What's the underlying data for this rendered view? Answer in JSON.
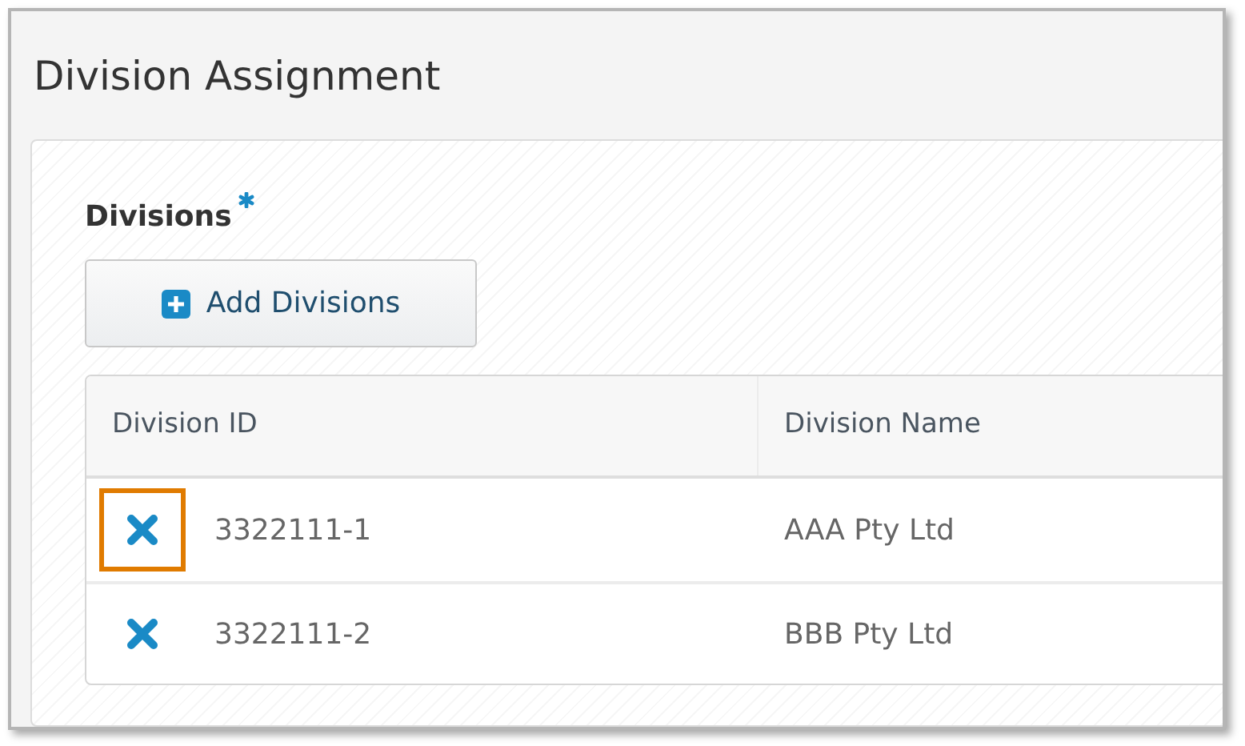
{
  "title": "Division Assignment",
  "section": {
    "label": "Divisions",
    "required": true
  },
  "add_button": {
    "label": "Add Divisions"
  },
  "table": {
    "columns": [
      "Division ID",
      "Division Name"
    ],
    "rows": [
      {
        "id": "3322111-1",
        "name": "AAA Pty Ltd",
        "highlighted": true
      },
      {
        "id": "3322111-2",
        "name": "BBB Pty Ltd",
        "highlighted": false
      }
    ]
  }
}
